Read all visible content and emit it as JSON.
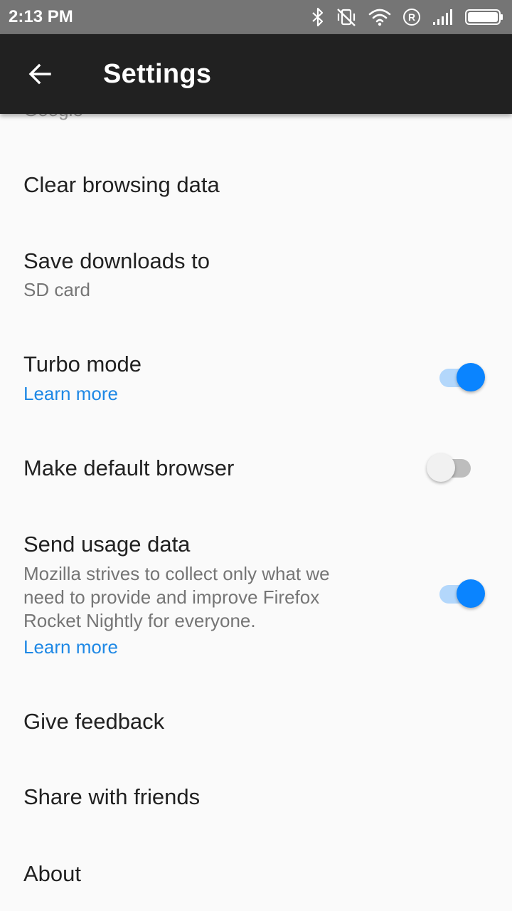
{
  "status_bar": {
    "time": "2:13 PM",
    "icons": [
      "bluetooth-icon",
      "vibrate-off-icon",
      "wifi-icon",
      "roaming-icon",
      "signal-icon",
      "battery-icon"
    ]
  },
  "app_bar": {
    "back_icon": "arrow-back-icon",
    "title": "Settings"
  },
  "settings": {
    "partial_item": "Google",
    "clear_browsing": {
      "title": "Clear browsing data"
    },
    "save_downloads": {
      "title": "Save downloads to",
      "value": "SD card"
    },
    "turbo_mode": {
      "title": "Turbo mode",
      "link": "Learn more",
      "enabled": true
    },
    "default_browser": {
      "title": "Make default browser",
      "enabled": false
    },
    "usage_data": {
      "title": "Send usage data",
      "description": "Mozilla strives to collect only what we need to provide and improve Firefox Rocket Nightly for everyone.",
      "link": "Learn more",
      "enabled": true
    },
    "feedback": {
      "title": "Give feedback"
    },
    "share": {
      "title": "Share with friends"
    },
    "about": {
      "title": "About"
    }
  },
  "colors": {
    "accent": "#0a84ff",
    "link": "#1e88e5",
    "app_bar": "#212121",
    "status_bar": "#757575",
    "background": "#fafafa"
  }
}
